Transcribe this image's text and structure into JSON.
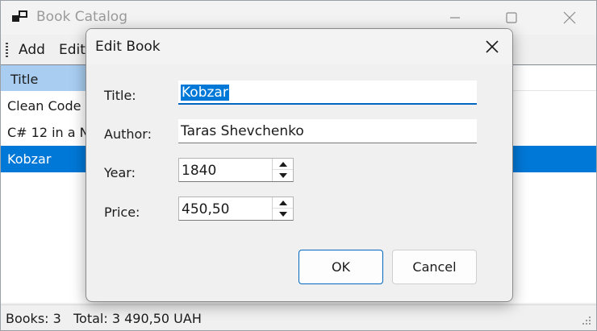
{
  "window": {
    "title": "Book Catalog",
    "icons": {
      "app": "app-window-icon",
      "minimize": "minimize-icon",
      "maximize": "maximize-icon",
      "close": "close-icon"
    }
  },
  "menu": {
    "items": [
      "Add",
      "Edit"
    ]
  },
  "list": {
    "column_header": "Title",
    "rows": [
      "Clean Code",
      "C# 12 in a N",
      "Kobzar"
    ],
    "selected_index": 2
  },
  "status": {
    "count": "Books: 3",
    "total": "Total: 3 490,50 UAH"
  },
  "dialog": {
    "title": "Edit Book",
    "fields": {
      "title": {
        "label": "Title:",
        "value": "Kobzar"
      },
      "author": {
        "label": "Author:",
        "value": "Taras Shevchenko"
      },
      "year": {
        "label": "Year:",
        "value": "1840"
      },
      "price": {
        "label": "Price:",
        "value": "450,50"
      }
    },
    "buttons": {
      "ok": "OK",
      "cancel": "Cancel"
    }
  },
  "colors": {
    "selection": "#0078d7",
    "header_highlight": "#a8cdf0",
    "accent": "#0067c0"
  }
}
